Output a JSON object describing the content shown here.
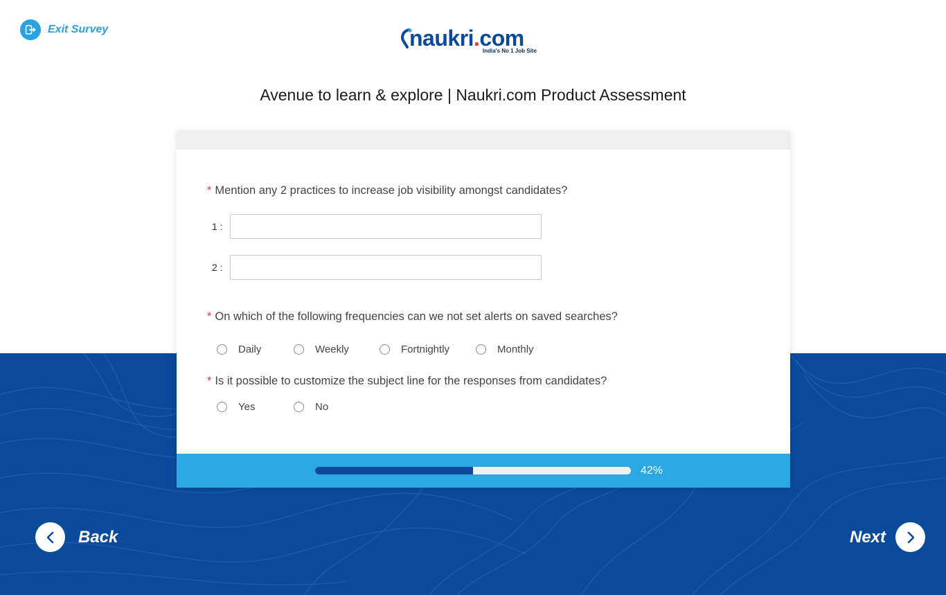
{
  "header": {
    "exit_label": "Exit Survey",
    "logo_text_main": "naukri",
    "logo_text_dot": ".",
    "logo_text_com": "com",
    "logo_tagline": "India's No 1 Job Site",
    "page_title": "Avenue to learn & explore | Naukri.com Product Assessment"
  },
  "colors": {
    "brand_blue": "#0b4a9a",
    "accent_light_blue": "#2aa8e2",
    "required_red": "#e53935"
  },
  "questions": [
    {
      "required_mark": "*",
      "text": "Mention any 2 practices to increase job visibility amongst candidates?",
      "fields": [
        {
          "label": "1 :",
          "value": ""
        },
        {
          "label": "2 :",
          "value": ""
        }
      ]
    },
    {
      "required_mark": "*",
      "text": "On which of the following frequencies can we not set alerts on saved searches?",
      "options": [
        "Daily",
        "Weekly",
        "Fortnightly",
        "Monthly"
      ]
    },
    {
      "required_mark": "*",
      "text": "Is it possible to customize the subject line for the responses from candidates?",
      "options": [
        "Yes",
        "No"
      ]
    }
  ],
  "progress": {
    "value": 0.5,
    "label": "42%"
  },
  "nav": {
    "back_label": "Back",
    "next_label": "Next"
  }
}
